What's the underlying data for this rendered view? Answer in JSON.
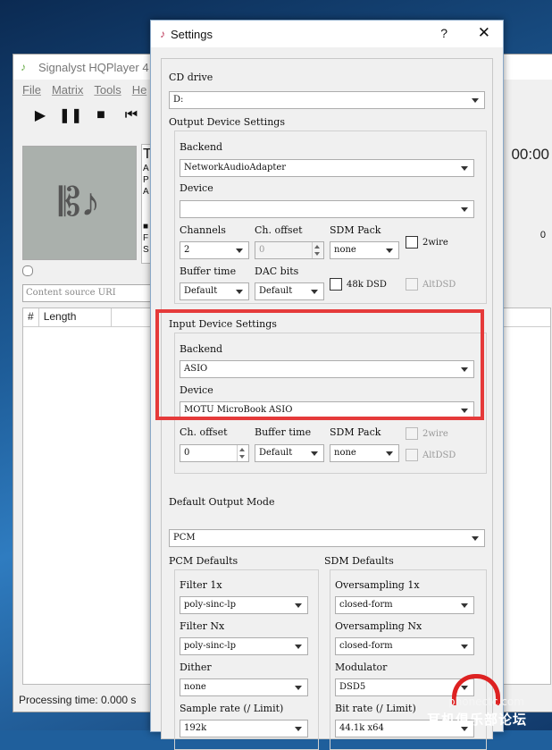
{
  "hq": {
    "title": "Signalyst HQPlayer 4",
    "menu": [
      "File",
      "Matrix",
      "Tools",
      "He"
    ],
    "time": "00:00",
    "info_letters": [
      "T",
      "A",
      "P",
      "A",
      "",
      "",
      "■",
      "F",
      "S"
    ],
    "right_value": "0",
    "uri_placeholder": "Content source URI",
    "col_num": "#",
    "col_length": "Length",
    "status": "Processing time: 0.000 s"
  },
  "settings": {
    "title": "Settings",
    "help": "?",
    "close": "✕",
    "cd_drive_label": "CD drive",
    "cd_drive_value": "D:",
    "output_group": "Output Device Settings",
    "out_backend_label": "Backend",
    "out_backend_value": "NetworkAudioAdapter",
    "out_device_label": "Device",
    "out_device_value": "",
    "channels_label": "Channels",
    "channels_value": "2",
    "ch_offset_label": "Ch. offset",
    "ch_offset_value": "0",
    "sdm_pack_label": "SDM Pack",
    "sdm_pack_value": "none",
    "twowire_label": "2wire",
    "buffer_time_label": "Buffer time",
    "buffer_time_value": "Default",
    "dac_bits_label": "DAC bits",
    "dac_bits_value": "Default",
    "dsd48k_label": "48k DSD",
    "altdsd_label": "AltDSD",
    "input_group": "Input Device Settings",
    "in_backend_label": "Backend",
    "in_backend_value": "ASIO",
    "in_device_label": "Device",
    "in_device_value": "MOTU MicroBook ASIO",
    "in_ch_offset_label": "Ch. offset",
    "in_ch_offset_value": "0",
    "in_buffer_time_label": "Buffer time",
    "in_buffer_time_value": "Default",
    "in_sdm_pack_label": "SDM Pack",
    "in_sdm_pack_value": "none",
    "in_twowire_label": "2wire",
    "in_altdsd_label": "AltDSD",
    "default_output_mode_label": "Default Output Mode",
    "default_output_mode_value": "PCM",
    "pcm_defaults_label": "PCM Defaults",
    "sdm_defaults_label": "SDM Defaults",
    "filter1x_label": "Filter 1x",
    "filter1x_value": "poly-sinc-lp",
    "filterNx_label": "Filter Nx",
    "filterNx_value": "poly-sinc-lp",
    "dither_label": "Dither",
    "dither_value": "none",
    "sample_rate_label": "Sample rate (/ Limit)",
    "sample_rate_value": "192k",
    "os1x_label": "Oversampling 1x",
    "os1x_value": "closed-form",
    "osNx_label": "Oversampling Nx",
    "osNx_value": "closed-form",
    "modulator_label": "Modulator",
    "modulator_value": "DSD5",
    "bit_rate_label": "Bit rate (/ Limit)",
    "bit_rate_value": "44.1k x64"
  },
  "watermark": {
    "site": "phonectc.com",
    "text": "耳机俱乐部论坛"
  },
  "colors": {
    "highlight": "#e53a3a",
    "desktop": "#1f5f9c"
  }
}
